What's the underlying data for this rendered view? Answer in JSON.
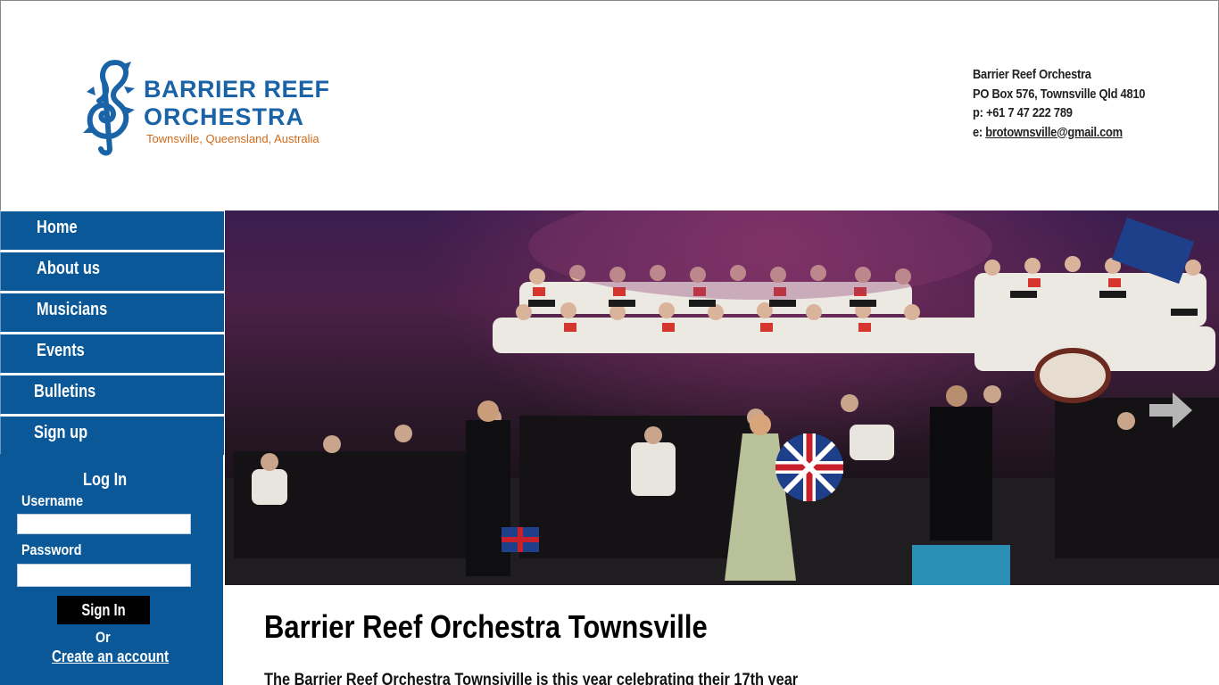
{
  "header": {
    "logo": {
      "line1": "BARRIER REEF",
      "line2": "ORCHESTRA",
      "tagline": "Townsville, Queensland, Australia",
      "brand_blue": "#1a63a6",
      "brand_orange": "#d26a1a",
      "icon": "treble-clef-seahorse-icon"
    },
    "contact": {
      "name": "Barrier Reef Orchestra",
      "address": "PO Box 576, Townsville Qld 4810",
      "phone": "p: +61 7 47 222 789",
      "email_prefix": "e: ",
      "email": "brotownsville@gmail.com"
    }
  },
  "nav": {
    "items": [
      {
        "label": "Home"
      },
      {
        "label": "About us"
      },
      {
        "label": "Musicians"
      },
      {
        "label": "Events"
      },
      {
        "label": "Bulletins"
      },
      {
        "label": "Sign up"
      }
    ],
    "color": "#0a5898"
  },
  "login": {
    "title": "Log In",
    "username_label": "Username",
    "username_value": "",
    "password_label": "Password",
    "password_value": "",
    "signin_label": "Sign In",
    "or_text": "Or",
    "create_account": "Create an account"
  },
  "hero": {
    "next_icon": "arrow-right-icon"
  },
  "main": {
    "title": "Barrier Reef Orchestra Townsville",
    "intro": "The Barrier Reef  Orchestra Townsiville is this year celebrating their 17th year"
  }
}
